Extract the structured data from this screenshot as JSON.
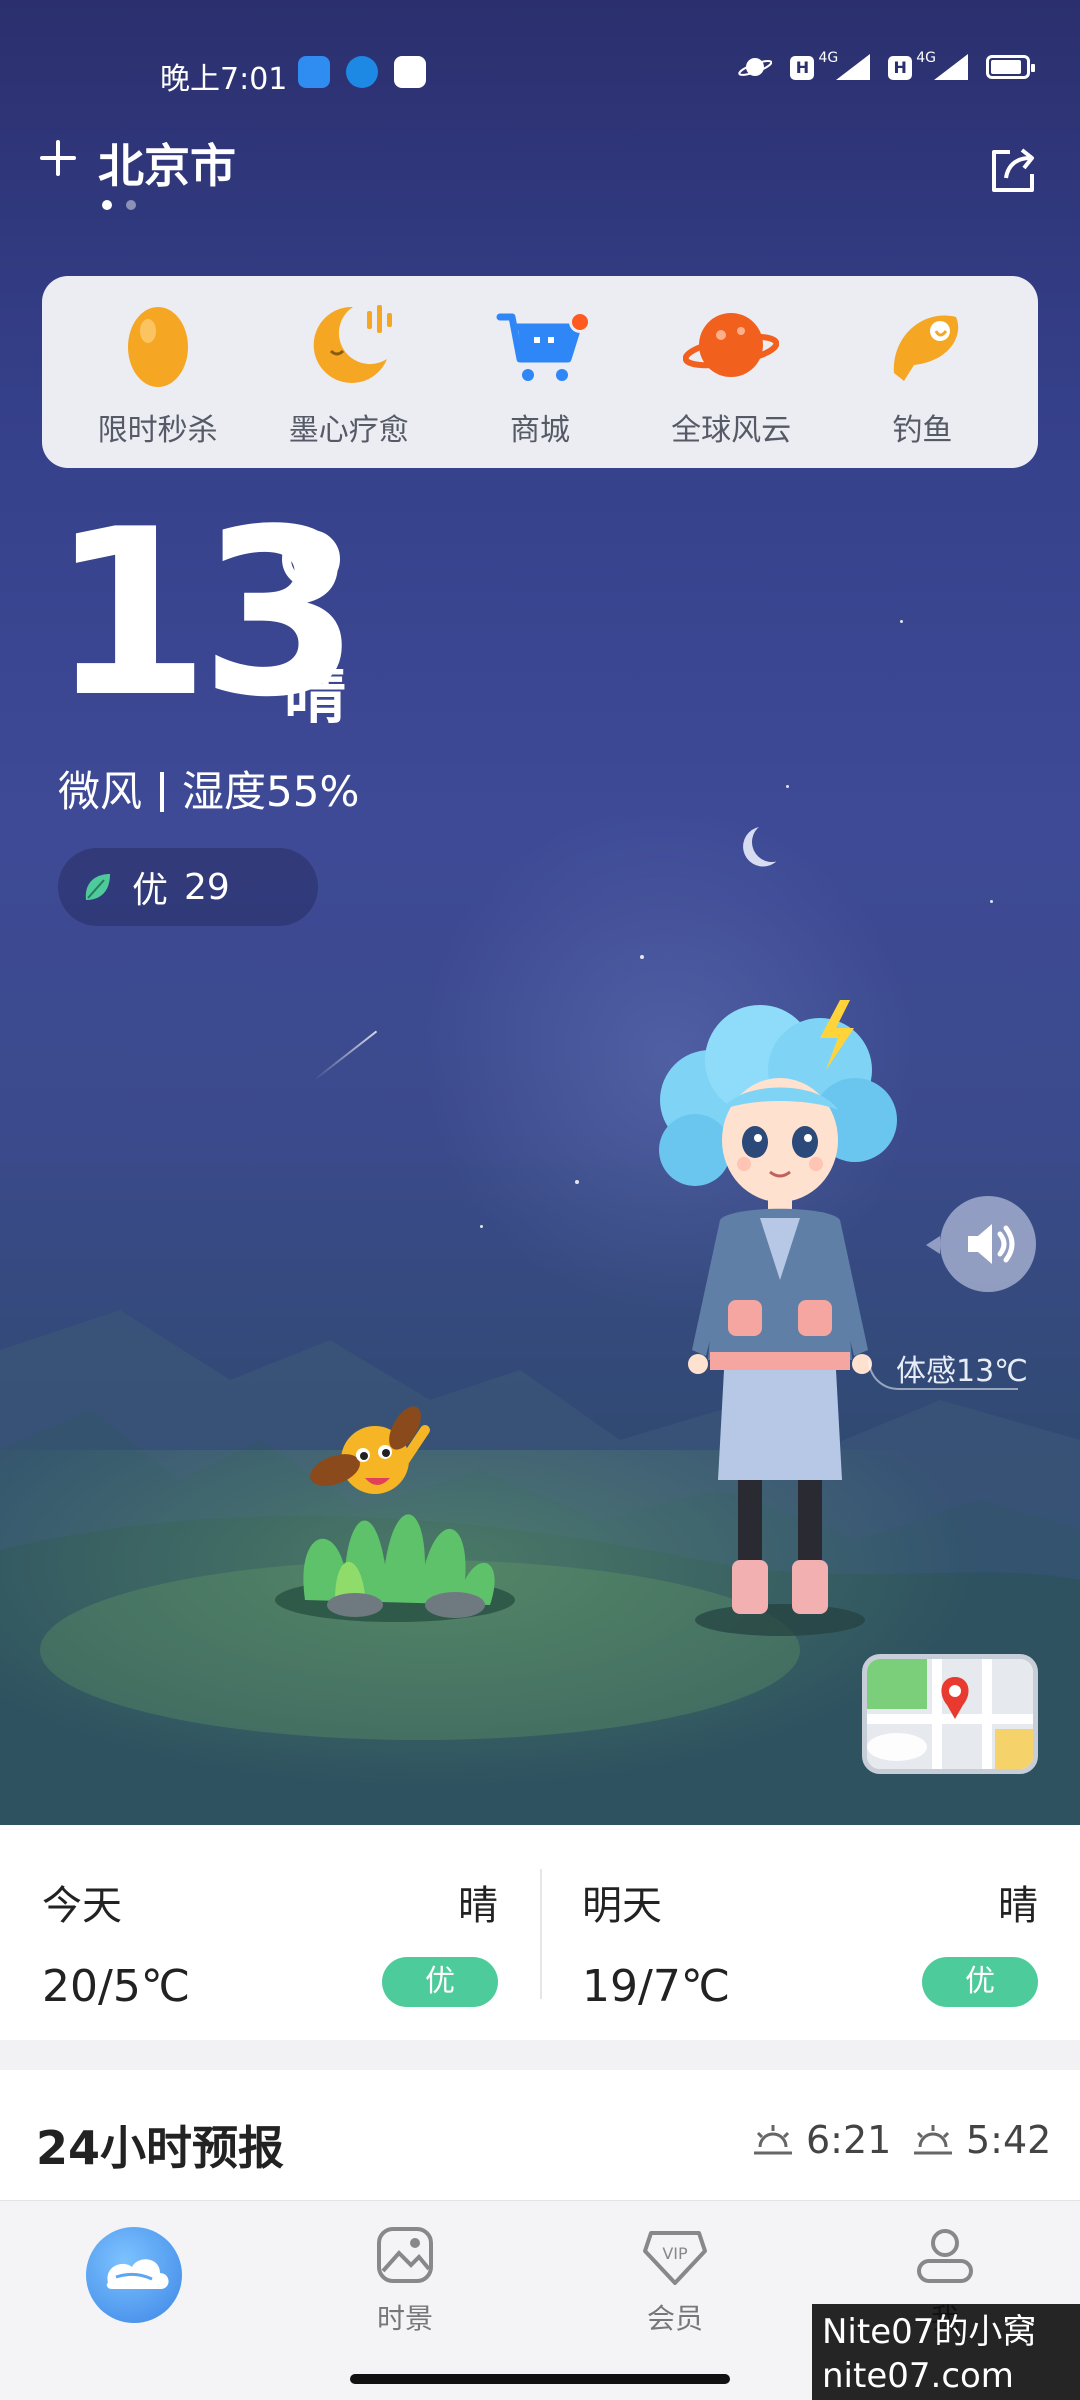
{
  "status_bar": {
    "time": "晚上7:01",
    "network_1": "4G",
    "network_2": "4G",
    "sim_1_label": "H",
    "sim_2_label": "H"
  },
  "header": {
    "city": "北京市",
    "page_dots": 2,
    "active_dot": 0
  },
  "quick_menu": [
    {
      "label": "限时秒杀",
      "icon": "egg-icon"
    },
    {
      "label": "墨心疗愈",
      "icon": "moon-icon"
    },
    {
      "label": "商城",
      "icon": "cart-icon",
      "badge": true
    },
    {
      "label": "全球风云",
      "icon": "planet-icon"
    },
    {
      "label": "钓鱼",
      "icon": "fish-icon"
    }
  ],
  "current": {
    "temperature": "13",
    "condition": "晴",
    "wind": "微风",
    "humidity": "湿度55%",
    "aqi_label": "优",
    "aqi_value": "29",
    "feels_like": "体感13℃"
  },
  "forecast": {
    "today": {
      "day": "今天",
      "weather": "晴",
      "range": "20/5℃",
      "aqi": "优"
    },
    "tomorrow": {
      "day": "明天",
      "weather": "晴",
      "range": "19/7℃",
      "aqi": "优"
    }
  },
  "hourly": {
    "title": "24小时预报",
    "sunrise": "6:21",
    "sunset": "5:42"
  },
  "nav": {
    "items": [
      {
        "label": ""
      },
      {
        "label": "时景"
      },
      {
        "label": "会员"
      },
      {
        "label": "我"
      }
    ]
  },
  "watermark": {
    "line1": "Nite07的小窝",
    "line2": "nite07.com"
  },
  "colors": {
    "aqi_good": "#4ecb9b",
    "badge": "#ff5a1f",
    "sky_top": "#2b2f6e"
  }
}
